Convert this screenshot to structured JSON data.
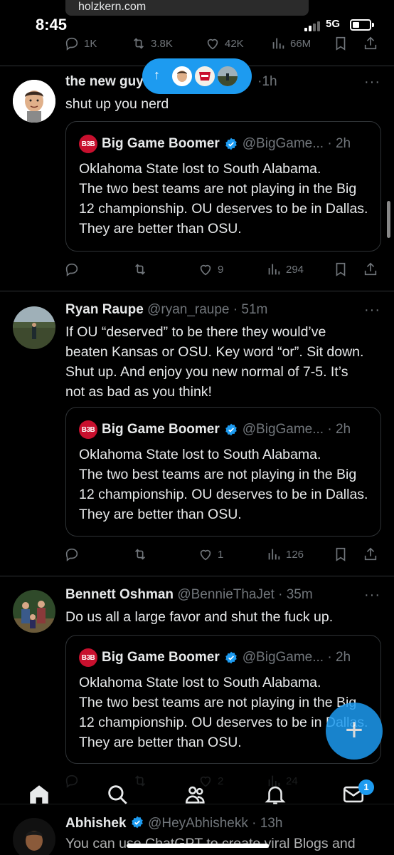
{
  "status_bar": {
    "link_chip": "holzkern.com",
    "time": "8:45",
    "network": "5G"
  },
  "top_tweet_actions": {
    "replies": "1K",
    "retweets": "3.8K",
    "likes": "42K",
    "views": "66M"
  },
  "new_posts_pill": {
    "arrow": "↑"
  },
  "tweets": [
    {
      "author": "the new guy",
      "handle_time": "·1h",
      "text": "shut up you nerd",
      "quote": {
        "logo": "B3B",
        "author": "Big Game Boomer",
        "handle_time": "@BigGame... · 2h",
        "text": "Oklahoma State lost to South Alabama.\nThe two best teams are not playing in the Big 12 championship.  OU deserves to be in Dallas.  They are better than OSU."
      },
      "actions": {
        "replies": "",
        "retweets": "",
        "likes": "9",
        "views": "294"
      }
    },
    {
      "author": "Ryan Raupe",
      "handle_time": "@ryan_raupe · 51m",
      "text": "If OU “deserved” to be there they would’ve beaten Kansas or OSU. Key word “or”. Sit down. Shut up. And enjoy you new normal of 7-5. It’s not as bad as you think!",
      "quote": {
        "logo": "B3B",
        "author": "Big Game Boomer",
        "handle_time": "@BigGame... · 2h",
        "text": "Oklahoma State lost to South Alabama.\nThe two best teams are not playing in the Big 12 championship.  OU deserves to be in Dallas.  They are better than OSU."
      },
      "actions": {
        "replies": "",
        "retweets": "",
        "likes": "1",
        "views": "126"
      }
    },
    {
      "author": "Bennett Oshman",
      "handle_time": "@BennieThaJet · 35m",
      "text": "Do us all a large favor and shut the fuck up.",
      "quote": {
        "logo": "B3B",
        "author": "Big Game Boomer",
        "handle_time": "@BigGame... · 2h",
        "text": "Oklahoma State lost to South Alabama.\nThe two best teams are not playing in the Big 12 championship.  OU deserves to be in Dallas.  They are better than OSU."
      },
      "actions": {
        "replies": "",
        "retweets": "",
        "likes": "2",
        "views": "24"
      }
    },
    {
      "author": "Abhishek",
      "handle_time": "@HeyAbhishekk · 13h",
      "text": "You can use ChatGPT to create viral Blogs and"
    }
  ],
  "bottom_nav": {
    "items": [
      "home",
      "search",
      "communities",
      "notifications",
      "messages"
    ],
    "messages_badge": "1"
  },
  "colors": {
    "background": "#000000",
    "accent": "#1d9bf0",
    "muted": "#71767b",
    "text": "#e7e9ea",
    "border": "#2f3336"
  }
}
